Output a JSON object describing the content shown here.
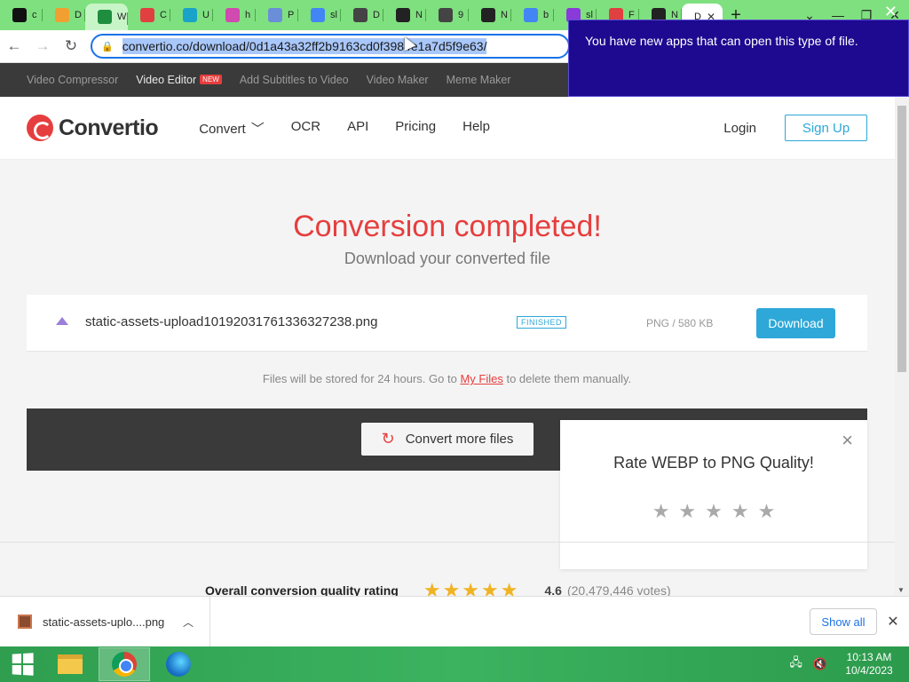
{
  "browser": {
    "tabs": [
      {
        "short": "c",
        "icon": "c-ai-icon",
        "color": "#111111"
      },
      {
        "short": "D",
        "icon": "pen-icon",
        "color": "#f0a030"
      },
      {
        "short": "W",
        "icon": "sheet-icon",
        "color": "#1e8e3e"
      },
      {
        "short": "C",
        "icon": "lock-icon",
        "color": "#e04040"
      },
      {
        "short": "U",
        "icon": "wave-icon",
        "color": "#1aa3c8"
      },
      {
        "short": "h",
        "icon": "square-icon",
        "color": "#d04ab0"
      },
      {
        "short": "P",
        "icon": "image-icon",
        "color": "#6a8fd8"
      },
      {
        "short": "sl",
        "icon": "google-icon",
        "color": "#4285f4"
      },
      {
        "short": "D",
        "icon": "download-icon",
        "color": "#444444"
      },
      {
        "short": "N",
        "icon": "ai-icon",
        "color": "#222222"
      },
      {
        "short": "9",
        "icon": "globe-icon",
        "color": "#444444"
      },
      {
        "short": "N",
        "icon": "ai-icon",
        "color": "#222222"
      },
      {
        "short": "b",
        "icon": "google-icon",
        "color": "#4285f4"
      },
      {
        "short": "sl",
        "icon": "shapes-icon",
        "color": "#8a3ad8"
      },
      {
        "short": "F",
        "icon": "flag-icon",
        "color": "#e04040"
      },
      {
        "short": "N",
        "icon": "ai-icon",
        "color": "#222222"
      }
    ],
    "current_tab": "D",
    "new_tab": "+",
    "window_controls": {
      "dropdown": "⌄",
      "minimize": "—",
      "restore": "❐",
      "close": "✕"
    },
    "url": "convertio.co/download/0d1a43a32ff2b9163cd0f3984e1a7d5f9e63/",
    "notification": "You have new apps that can open this type of file."
  },
  "site_strip": {
    "items": [
      "Video Compressor",
      "Video Editor",
      "Add Subtitles to Video",
      "Video Maker",
      "Meme Maker"
    ],
    "new_badge": "NEW"
  },
  "header": {
    "logo": "Convertio",
    "nav": [
      "Convert",
      "OCR",
      "API",
      "Pricing",
      "Help"
    ],
    "login": "Login",
    "signup": "Sign Up"
  },
  "main": {
    "title": "Conversion completed!",
    "subtitle": "Download your converted file",
    "file": {
      "name": "static-assets-upload10192031761336327238.png",
      "status": "FINISHED",
      "info": "PNG / 580 KB",
      "download": "Download"
    },
    "store_note_pre": "Files will be stored for 24 hours. Go to",
    "store_note_link": "My Files",
    "store_note_post": "to delete them manually.",
    "convert_more": "Convert more files",
    "rating_popup": {
      "title": "Rate WEBP to PNG Quality!",
      "stars": "★★★★★",
      "rating_value": 0
    },
    "overall": {
      "label": "Overall conversion quality rating",
      "stars": "★★★★★",
      "score": "4.6",
      "votes": "(20,479,446 votes)"
    }
  },
  "download_shelf": {
    "filename": "static-assets-uplo....png",
    "show_all": "Show all"
  },
  "taskbar": {
    "time": "10:13 AM",
    "date": "10/4/2023"
  },
  "colors": {
    "accent_red": "#e63e3e",
    "accent_blue": "#2da8d8",
    "tabstrip": "#7fe07f",
    "notification": "#1d0a90",
    "star_gold": "#f0b323"
  }
}
